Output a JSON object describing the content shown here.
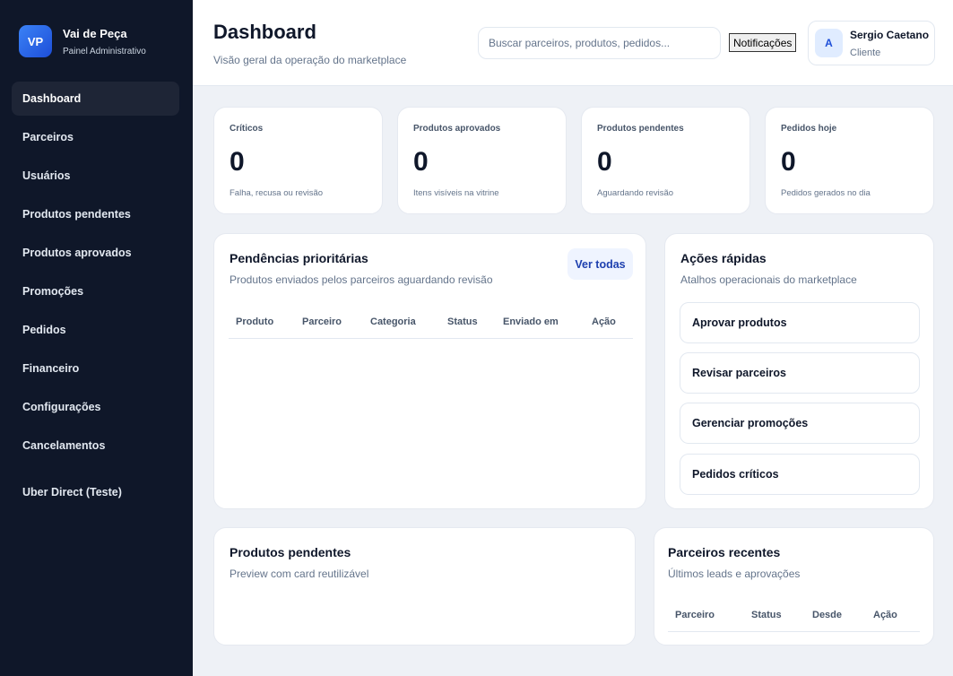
{
  "brand": {
    "logo": "VP",
    "name": "Vai de Peça",
    "subtitle": "Painel Administrativo"
  },
  "sidebar": {
    "items": [
      {
        "label": "Dashboard",
        "active": true
      },
      {
        "label": "Parceiros"
      },
      {
        "label": "Usuários"
      },
      {
        "label": "Produtos pendentes"
      },
      {
        "label": "Produtos aprovados"
      },
      {
        "label": "Promoções"
      },
      {
        "label": "Pedidos"
      },
      {
        "label": "Financeiro"
      },
      {
        "label": "Configurações"
      },
      {
        "label": "Cancelamentos"
      },
      {
        "label": "Uber Direct (Teste)"
      }
    ]
  },
  "header": {
    "title": "Dashboard",
    "subtitle": "Visão geral da operação do marketplace",
    "search_placeholder": "Buscar parceiros, produtos, pedidos...",
    "notifications_label": "Notificações",
    "user": {
      "avatar": "A",
      "name": "Sergio Caetano",
      "role": "Cliente"
    }
  },
  "stats": [
    {
      "label": "Críticos",
      "value": "0",
      "hint": "Falha, recusa ou revisão"
    },
    {
      "label": "Produtos aprovados",
      "value": "0",
      "hint": "Itens visíveis na vitrine"
    },
    {
      "label": "Produtos pendentes",
      "value": "0",
      "hint": "Aguardando revisão"
    },
    {
      "label": "Pedidos hoje",
      "value": "0",
      "hint": "Pedidos gerados no dia"
    }
  ],
  "pending": {
    "title": "Pendências prioritárias",
    "subtitle": "Produtos enviados pelos parceiros aguardando revisão",
    "see_all": "Ver todas",
    "columns": [
      "Produto",
      "Parceiro",
      "Categoria",
      "Status",
      "Enviado em",
      "Ação"
    ]
  },
  "quick_actions": {
    "title": "Ações rápidas",
    "subtitle": "Atalhos operacionais do marketplace",
    "items": [
      "Aprovar produtos",
      "Revisar parceiros",
      "Gerenciar promoções",
      "Pedidos críticos"
    ]
  },
  "pending_products": {
    "title": "Produtos pendentes",
    "subtitle": "Preview com card reutilizável"
  },
  "recent_partners": {
    "title": "Parceiros recentes",
    "subtitle": "Últimos leads e aprovações",
    "columns": [
      "Parceiro",
      "Status",
      "Desde",
      "Ação"
    ]
  },
  "colors": {
    "sidebar": "#0f1729",
    "accent": "#2563eb",
    "background": "#eef1f6"
  }
}
